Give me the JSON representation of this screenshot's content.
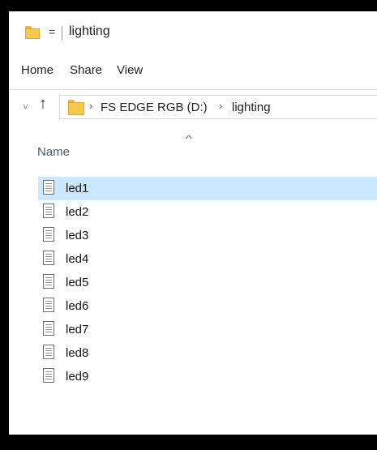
{
  "window": {
    "title": "lighting",
    "qa_glyph": "=",
    "accent": "#f5c84a"
  },
  "ribbon": {
    "tabs": [
      "Home",
      "Share",
      "View"
    ]
  },
  "address": {
    "history_glyph": "˅",
    "up_glyph": "↑",
    "chevron": "›",
    "crumbs": [
      "FS EDGE RGB (D:)",
      "lighting"
    ]
  },
  "columns": {
    "name": "Name",
    "sort_glyph": "^"
  },
  "files": [
    {
      "name": "led1",
      "selected": true
    },
    {
      "name": "led2"
    },
    {
      "name": "led3"
    },
    {
      "name": "led4"
    },
    {
      "name": "led5"
    },
    {
      "name": "led6"
    },
    {
      "name": "led7"
    },
    {
      "name": "led8"
    },
    {
      "name": "led9"
    }
  ],
  "colors": {
    "selection": "#cce8ff",
    "folder": "#f5c84a"
  }
}
